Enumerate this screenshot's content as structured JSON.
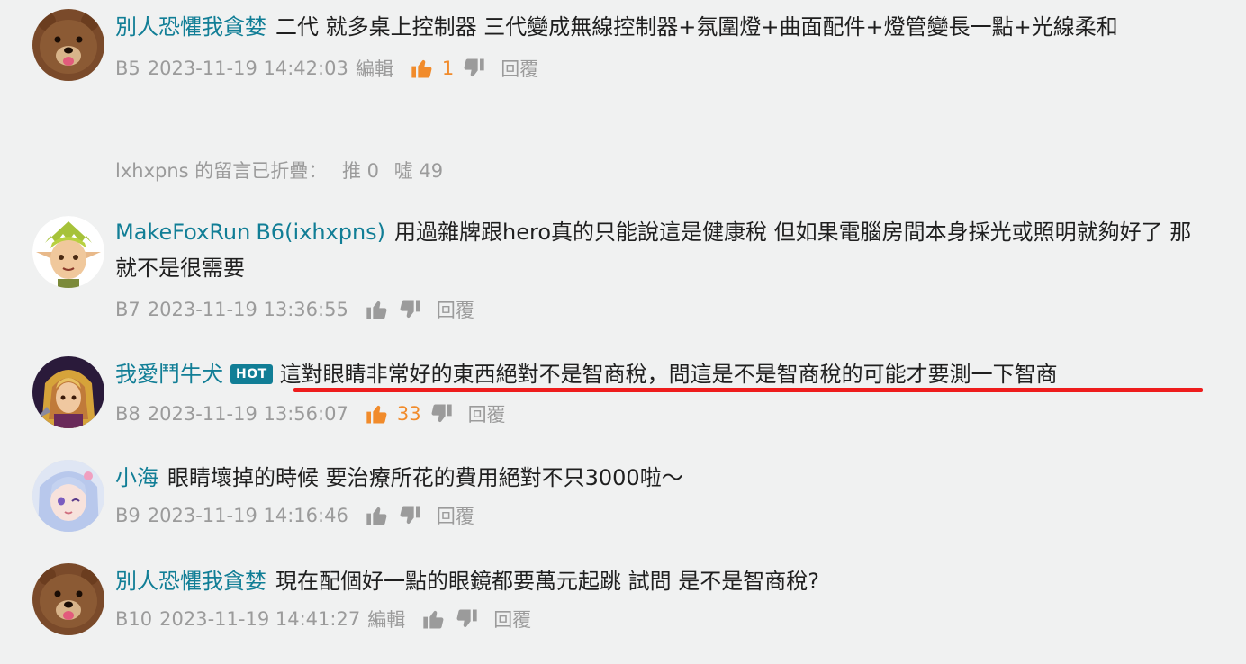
{
  "colors": {
    "name": "#117e96",
    "like_active": "#f18b2b",
    "meta": "#9b9b9b",
    "highlight": "#ee1c1c",
    "background": "#f0f1f1"
  },
  "comments": [
    {
      "id": "c1",
      "username": "別人恐懼我貪婪",
      "text": "二代 就多桌上控制器 三代變成無線控制器+氛圍燈+曲面配件+燈管變長一點+光線柔和",
      "floor": "B5",
      "time": "2023-11-19 14:42:03",
      "edit": "編輯",
      "likes": "1",
      "reply": "回覆"
    },
    {
      "id": "c2",
      "username": "MakeFoxRun",
      "floor_label": "B6(ixhxpns)",
      "text": "用過雜牌跟hero真的只能說這是健康稅 但如果電腦房間本身採光或照明就夠好了 那就不是很需要",
      "floor": "B7",
      "time": "2023-11-19 13:36:55",
      "likes": "",
      "reply": "回覆"
    },
    {
      "id": "c3",
      "username": "我愛鬥牛犬",
      "badge": "HOT",
      "text": "這對眼睛非常好的東西絕對不是智商稅，問這是不是智商稅的可能才要測一下智商",
      "floor": "B8",
      "time": "2023-11-19 13:56:07",
      "likes": "33",
      "reply": "回覆"
    },
    {
      "id": "c4",
      "username": "小海",
      "text": "眼睛壞掉的時候 要治療所花的費用絕對不只3000啦～",
      "floor": "B9",
      "time": "2023-11-19 14:16:46",
      "likes": "",
      "reply": "回覆"
    },
    {
      "id": "c5",
      "username": "別人恐懼我貪婪",
      "text": "現在配個好一點的眼鏡都要萬元起跳 試問 是不是智商稅?",
      "floor": "B10",
      "time": "2023-11-19 14:41:27",
      "edit": "編輯",
      "likes": "",
      "reply": "回覆"
    }
  ],
  "folded": {
    "label": "lxhxpns 的留言已折疊：",
    "push_label": "推 0",
    "boo_label": "噓 49"
  }
}
